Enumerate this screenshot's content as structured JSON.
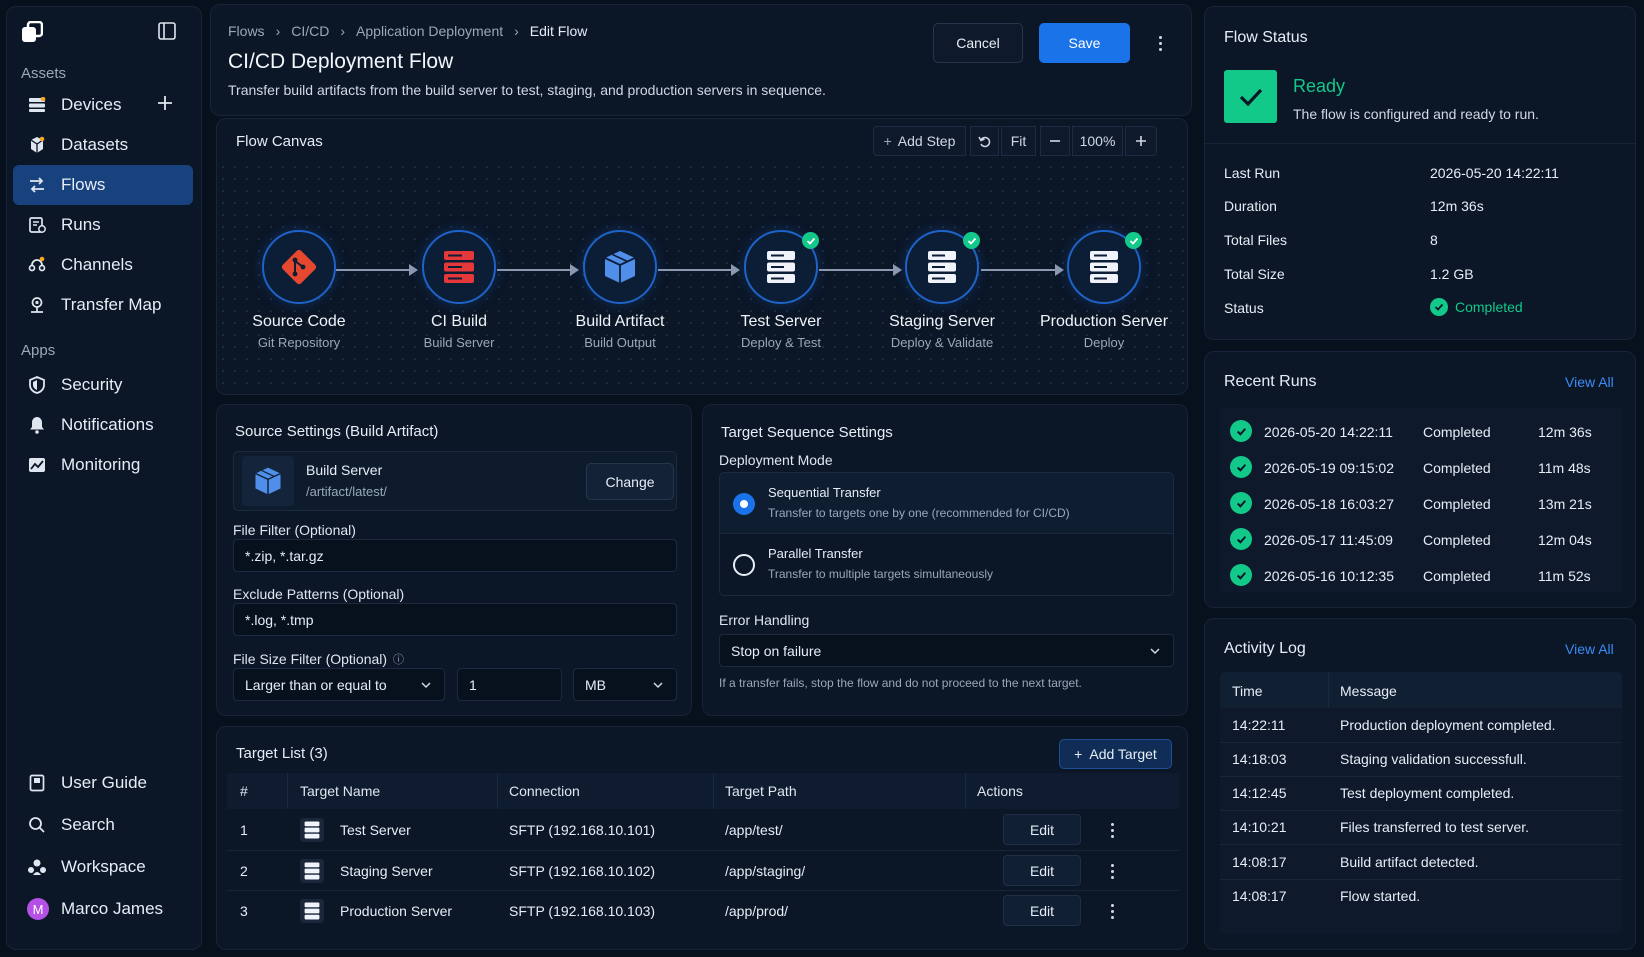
{
  "sidebar": {
    "assets_heading": "Assets",
    "apps_heading": "Apps",
    "items": [
      {
        "label": "Devices"
      },
      {
        "label": "Datasets"
      },
      {
        "label": "Flows"
      },
      {
        "label": "Runs"
      },
      {
        "label": "Channels"
      },
      {
        "label": "Transfer Map"
      },
      {
        "label": "Security"
      },
      {
        "label": "Notifications"
      },
      {
        "label": "Monitoring"
      }
    ],
    "bottom": [
      {
        "label": "User Guide"
      },
      {
        "label": "Search"
      },
      {
        "label": "Workspace"
      }
    ],
    "user": {
      "initial": "M",
      "name": "Marco James"
    }
  },
  "header": {
    "breadcrumb": [
      "Flows",
      "CI/CD",
      "Application Deployment",
      "Edit Flow"
    ],
    "title": "CI/CD Deployment Flow",
    "description": "Transfer build artifacts from the build server to test, staging, and production servers in sequence.",
    "cancel_label": "Cancel",
    "save_label": "Save"
  },
  "canvas": {
    "title": "Flow Canvas",
    "add_step_label": "Add Step",
    "fit_label": "Fit",
    "zoom": "100%",
    "nodes": [
      {
        "title": "Source Code",
        "subtitle": "Git Repository"
      },
      {
        "title": "CI Build",
        "subtitle": "Build Server"
      },
      {
        "title": "Build Artifact",
        "subtitle": "Build Output"
      },
      {
        "title": "Test Server",
        "subtitle": "Deploy & Test"
      },
      {
        "title": "Staging Server",
        "subtitle": "Deploy & Validate"
      },
      {
        "title": "Production Server",
        "subtitle": "Deploy"
      }
    ]
  },
  "source_settings": {
    "title": "Source Settings (Build Artifact)",
    "server_name": "Build Server",
    "server_path": "/artifact/latest/",
    "change_label": "Change",
    "file_filter_label": "File Filter (Optional)",
    "file_filter_value": "*.zip, *.tar.gz",
    "exclude_label": "Exclude Patterns (Optional)",
    "exclude_value": "*.log, *.tmp",
    "size_filter_label": "File Size Filter (Optional)",
    "size_condition": "Larger than or equal to",
    "size_value": "1",
    "size_unit": "MB"
  },
  "target_settings": {
    "title": "Target Sequence Settings",
    "mode_label": "Deployment Mode",
    "sequential_title": "Sequential Transfer",
    "sequential_desc": "Transfer to targets one by one (recommended for CI/CD)",
    "parallel_title": "Parallel Transfer",
    "parallel_desc": "Transfer to multiple targets simultaneously",
    "error_label": "Error Handling",
    "error_value": "Stop on failure",
    "error_help": "If a transfer fails, stop the flow and do not proceed to the next target."
  },
  "target_list": {
    "title": "Target List (3)",
    "add_label": "Add Target",
    "columns": [
      "#",
      "Target Name",
      "Connection",
      "Target Path",
      "Actions"
    ],
    "edit_label": "Edit",
    "rows": [
      {
        "num": "1",
        "name": "Test Server",
        "connection": "SFTP (192.168.10.101)",
        "path": "/app/test/"
      },
      {
        "num": "2",
        "name": "Staging Server",
        "connection": "SFTP (192.168.10.102)",
        "path": "/app/staging/"
      },
      {
        "num": "3",
        "name": "Production Server",
        "connection": "SFTP (192.168.10.103)",
        "path": "/app/prod/"
      }
    ]
  },
  "flow_status": {
    "title": "Flow Status",
    "state": "Ready",
    "state_desc": "The flow is configured and ready to run.",
    "details": [
      {
        "label": "Last Run",
        "value": "2026-05-20 14:22:11"
      },
      {
        "label": "Duration",
        "value": "12m 36s"
      },
      {
        "label": "Total Files",
        "value": "8"
      },
      {
        "label": "Total Size",
        "value": "1.2 GB"
      },
      {
        "label": "Status",
        "value": "Completed"
      }
    ],
    "accent": "#12c98a"
  },
  "recent_runs": {
    "title": "Recent Runs",
    "view_all": "View All",
    "rows": [
      {
        "time": "2026-05-20 14:22:11",
        "status": "Completed",
        "duration": "12m 36s"
      },
      {
        "time": "2026-05-19 09:15:02",
        "status": "Completed",
        "duration": "11m 48s"
      },
      {
        "time": "2026-05-18 16:03:27",
        "status": "Completed",
        "duration": "13m 21s"
      },
      {
        "time": "2026-05-17 11:45:09",
        "status": "Completed",
        "duration": "12m 04s"
      },
      {
        "time": "2026-05-16 10:12:35",
        "status": "Completed",
        "duration": "11m 52s"
      }
    ]
  },
  "activity_log": {
    "title": "Activity Log",
    "view_all": "View All",
    "columns": [
      "Time",
      "Message"
    ],
    "rows": [
      {
        "time": "14:22:11",
        "message": "Production deployment completed."
      },
      {
        "time": "14:18:03",
        "message": "Staging validation successfull."
      },
      {
        "time": "14:12:45",
        "message": "Test deployment completed."
      },
      {
        "time": "14:10:21",
        "message": "Files transferred to test server."
      },
      {
        "time": "14:08:17",
        "message": "Build artifact detected."
      },
      {
        "time": "14:08:17",
        "message": "Flow started."
      }
    ]
  },
  "colors": {
    "primary": "#1a73e8",
    "success": "#12c98a",
    "link": "#3b8cf5",
    "danger": "#e5482e"
  }
}
